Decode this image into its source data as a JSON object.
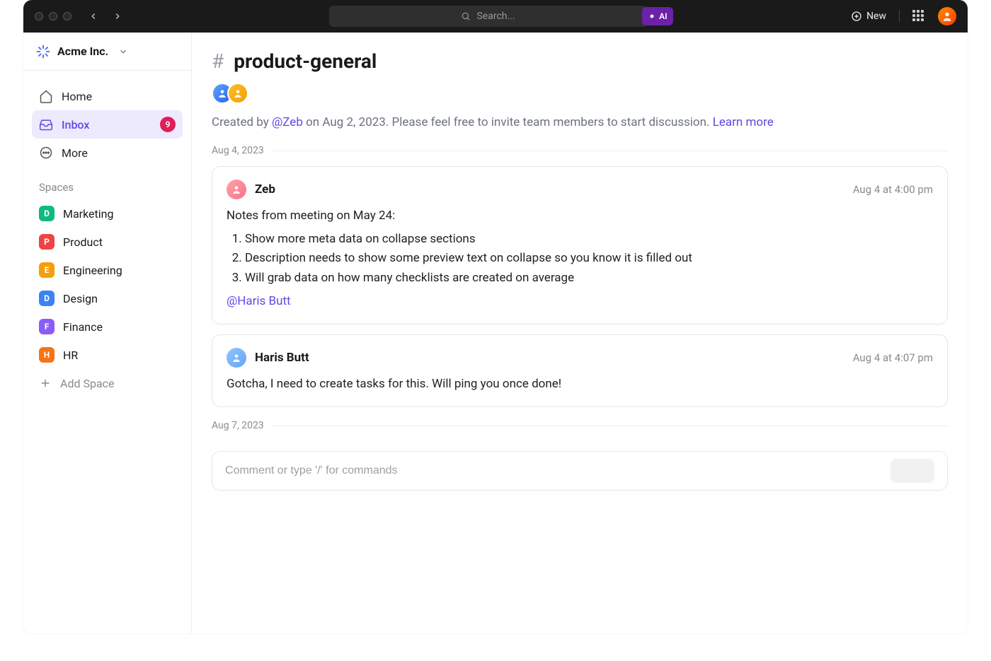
{
  "topbar": {
    "search_placeholder": "Search...",
    "ai_label": "AI",
    "new_label": "New"
  },
  "workspace": {
    "name": "Acme Inc."
  },
  "nav": {
    "home": "Home",
    "inbox": "Inbox",
    "inbox_badge": "9",
    "more": "More"
  },
  "spaces_heading": "Spaces",
  "spaces": [
    {
      "letter": "D",
      "label": "Marketing",
      "color": "#10b981"
    },
    {
      "letter": "P",
      "label": "Product",
      "color": "#ef4444"
    },
    {
      "letter": "E",
      "label": "Engineering",
      "color": "#f59e0b"
    },
    {
      "letter": "D",
      "label": "Design",
      "color": "#3b82f6"
    },
    {
      "letter": "F",
      "label": "Finance",
      "color": "#8b5cf6"
    },
    {
      "letter": "H",
      "label": "HR",
      "color": "#f97316"
    }
  ],
  "add_space_label": "Add Space",
  "channel": {
    "name": "product-general",
    "description_prefix": "Created by ",
    "creator": "@Zeb",
    "description_suffix": " on Aug 2, 2023. Please feel free to invite team members to start discussion. ",
    "learn_more": "Learn more"
  },
  "messages": {
    "date1": "Aug 4, 2023",
    "date2": "Aug 7, 2023",
    "m1": {
      "author": "Zeb",
      "time": "Aug 4 at 4:00 pm",
      "intro": "Notes from meeting on May 24:",
      "li1": "Show more meta data on collapse sections",
      "li2": "Description needs to show some preview text on collapse so you know it is filled out",
      "li3": "Will grab data on how many checklists are created on average",
      "mention": "@Haris Butt"
    },
    "m2": {
      "author": "Haris Butt",
      "time": "Aug 4 at 4:07 pm",
      "body": "Gotcha, I need to create tasks for this. Will ping you once done!"
    }
  },
  "composer": {
    "placeholder": "Comment or type '/' for commands"
  }
}
